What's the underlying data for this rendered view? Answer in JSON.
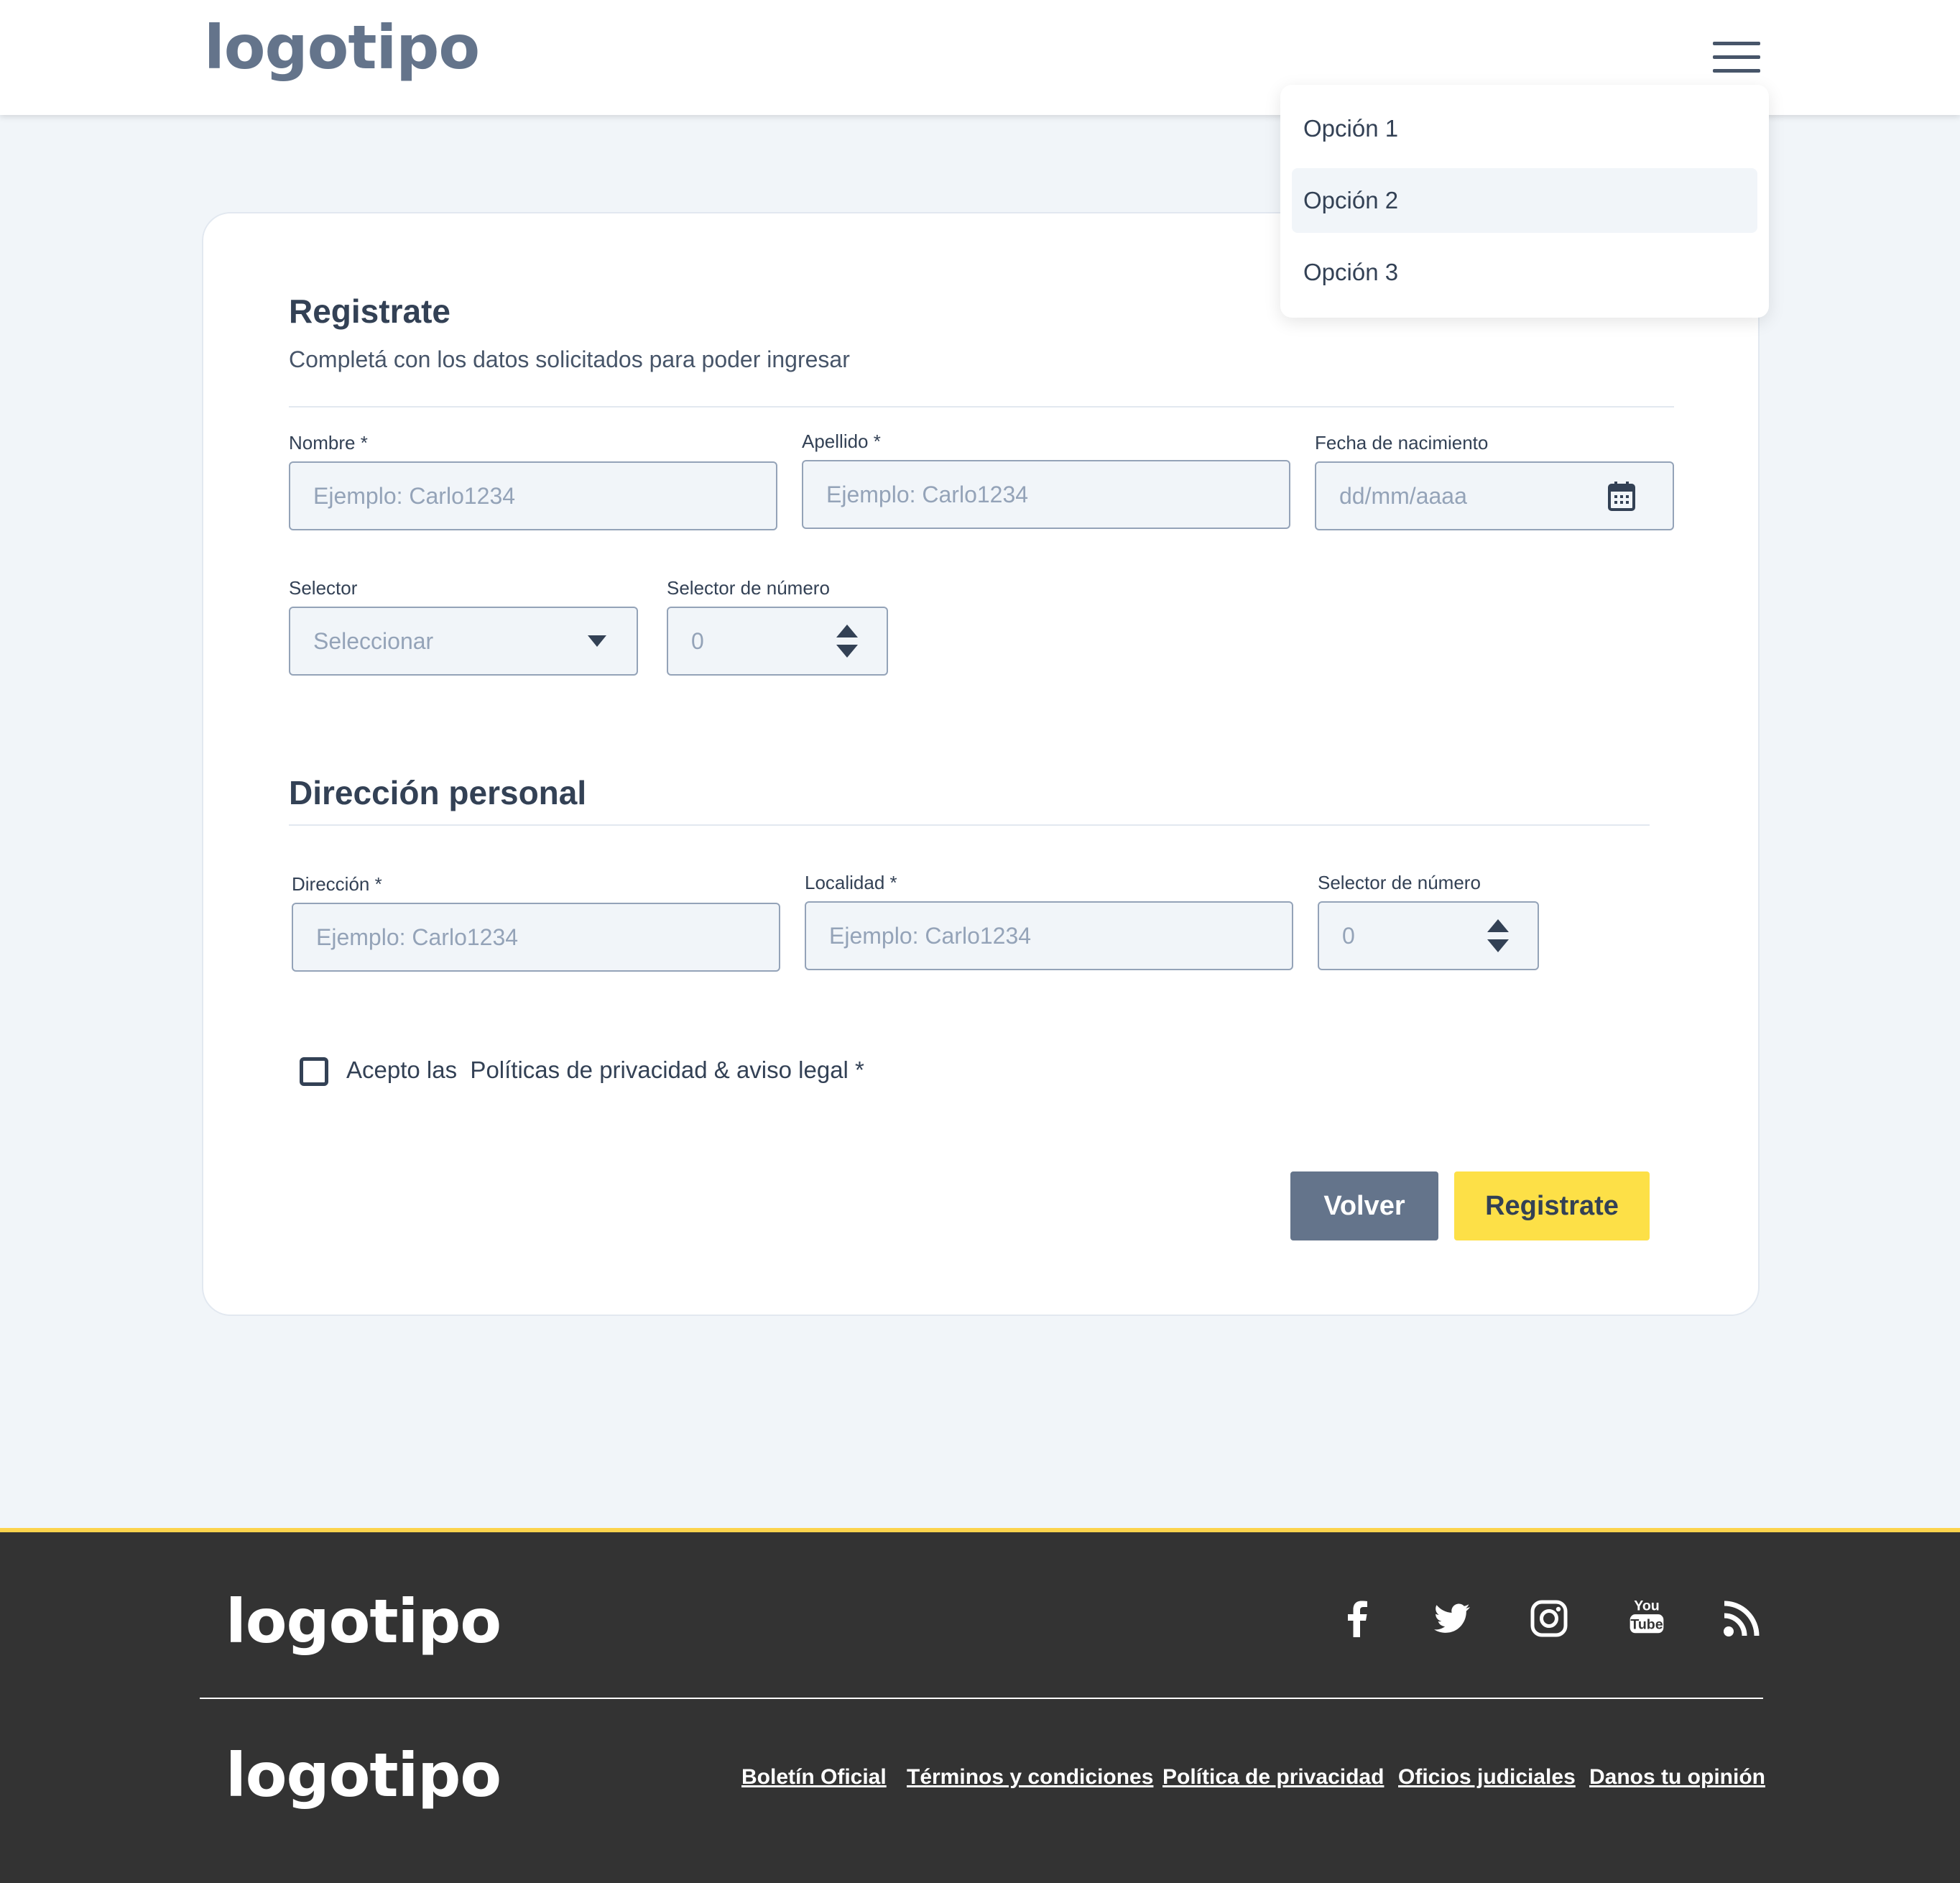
{
  "header": {
    "logo": "logotipo",
    "menu": [
      "Opción 1",
      "Opción 2",
      "Opción 3"
    ]
  },
  "form": {
    "title": "Registrate",
    "subtitle": "Completá con los datos solicitados para poder ingresar",
    "nombre": {
      "label": "Nombre *",
      "placeholder": "Ejemplo: Carlo1234"
    },
    "apellido": {
      "label": "Apellido *",
      "placeholder": "Ejemplo: Carlo1234"
    },
    "fecha": {
      "label": "Fecha de nacimiento",
      "placeholder": "dd/mm/aaaa"
    },
    "selector": {
      "label": "Selector",
      "value": "Seleccionar"
    },
    "numero": {
      "label": "Selector de número",
      "value": "0"
    },
    "address_title": "Dirección personal",
    "direccion": {
      "label": "Dirección *",
      "placeholder": "Ejemplo: Carlo1234"
    },
    "localidad": {
      "label": "Localidad  *",
      "placeholder": "Ejemplo: Carlo1234"
    },
    "numero2": {
      "label": "Selector de número",
      "value": "0"
    },
    "checkbox_label": "Acepto las  Políticas de privacidad & aviso legal *",
    "back_label": "Volver",
    "submit_label": "Registrate"
  },
  "footer": {
    "logo_top": "logotipo",
    "logo_bottom": "logotipo",
    "links": [
      "Boletín Oficial",
      "Términos y condiciones",
      "Política de privacidad",
      "Oficios judiciales",
      "Danos tu opinión"
    ],
    "social_icons": [
      "facebook-icon",
      "twitter-icon",
      "instagram-icon",
      "youtube-icon",
      "rss-icon"
    ],
    "youtube_text": [
      "You",
      "Tube"
    ]
  },
  "colors": {
    "accent": "#fde047",
    "dark": "#333333",
    "slate": "#64748b"
  }
}
